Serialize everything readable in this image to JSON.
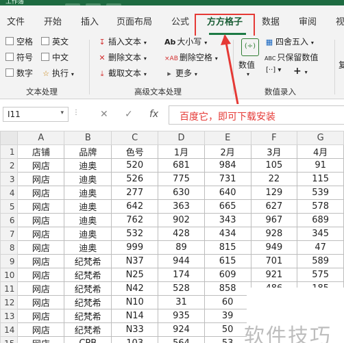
{
  "app": {
    "title": "工作簿"
  },
  "tabs": [
    "文件",
    "开始",
    "插入",
    "页面布局",
    "公式",
    "方方格子",
    "数据",
    "审阅",
    "视"
  ],
  "ribbon": {
    "text_group": {
      "checks": [
        "空格",
        "英文",
        "符号",
        "中文",
        "数字"
      ],
      "execute": "执行",
      "label": "文本处理"
    },
    "advanced_group": {
      "items": [
        "插入文本",
        "删除文本",
        "截取文本",
        "大小写",
        "删除空格",
        "更多"
      ],
      "label": "高级文本处理"
    },
    "number_group": {
      "value_btn": "数值",
      "items": [
        "四舍五入",
        "只保留数值"
      ],
      "plus": "+",
      "label": "数值录入",
      "cutoff": "复"
    }
  },
  "formula_bar": {
    "cell_ref": "I11",
    "fx": "fx",
    "content": "百度它，即可下载安装"
  },
  "columns": [
    "A",
    "B",
    "C",
    "D",
    "E",
    "F",
    "G"
  ],
  "rows": [
    [
      "1",
      "店铺",
      "品牌",
      "色号",
      "1月",
      "2月",
      "3月",
      "4月"
    ],
    [
      "2",
      "网店",
      "迪奥",
      "520",
      "681",
      "984",
      "105",
      "91"
    ],
    [
      "3",
      "网店",
      "迪奥",
      "526",
      "775",
      "731",
      "22",
      "115"
    ],
    [
      "4",
      "网店",
      "迪奥",
      "277",
      "630",
      "640",
      "129",
      "539"
    ],
    [
      "5",
      "网店",
      "迪奥",
      "642",
      "363",
      "665",
      "627",
      "578"
    ],
    [
      "6",
      "网店",
      "迪奥",
      "762",
      "902",
      "343",
      "967",
      "689"
    ],
    [
      "7",
      "网店",
      "迪奥",
      "532",
      "428",
      "434",
      "928",
      "345"
    ],
    [
      "8",
      "网店",
      "迪奥",
      "999",
      "89",
      "815",
      "949",
      "47"
    ],
    [
      "9",
      "网店",
      "纪梵希",
      "N37",
      "944",
      "615",
      "701",
      "589"
    ],
    [
      "10",
      "网店",
      "纪梵希",
      "N25",
      "174",
      "609",
      "921",
      "575"
    ],
    [
      "11",
      "网店",
      "纪梵希",
      "N42",
      "528",
      "858",
      "486",
      "185"
    ],
    [
      "12",
      "网店",
      "纪梵希",
      "N10",
      "31",
      "60",
      "",
      ""
    ],
    [
      "13",
      "网店",
      "纪梵希",
      "N14",
      "935",
      "39",
      "",
      ""
    ],
    [
      "14",
      "网店",
      "纪梵希",
      "N33",
      "924",
      "50",
      "",
      ""
    ],
    [
      "15",
      "网店",
      "CPB",
      "103",
      "564",
      "53",
      "",
      ""
    ]
  ],
  "watermark": "软件技巧",
  "colors": {
    "brand": "#1e6b41",
    "annotation": "#e53935"
  }
}
